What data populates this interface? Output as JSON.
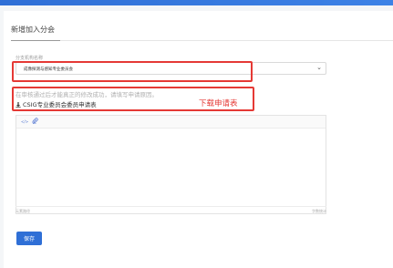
{
  "page": {
    "title": "新增加入分会"
  },
  "form": {
    "branch_label": "分支机构名称",
    "branch_value": "成像探测与感知专业委员会",
    "hint": "在审核通过后才能真正的修改成功，请填写申请原因。",
    "download_text": "CSIG专业委员会委员申请表",
    "annotation": "下载申请表",
    "editor_status_left": "元素路径",
    "editor_status_right": "字数统计"
  },
  "actions": {
    "save_label": "保存"
  },
  "colors": {
    "accent": "#2f6fd6",
    "highlight": "#e53935"
  },
  "icons": {
    "select": "chevron-down-icon",
    "download": "download-icon",
    "toolbar": [
      "html-icon",
      "attachment-icon"
    ]
  }
}
